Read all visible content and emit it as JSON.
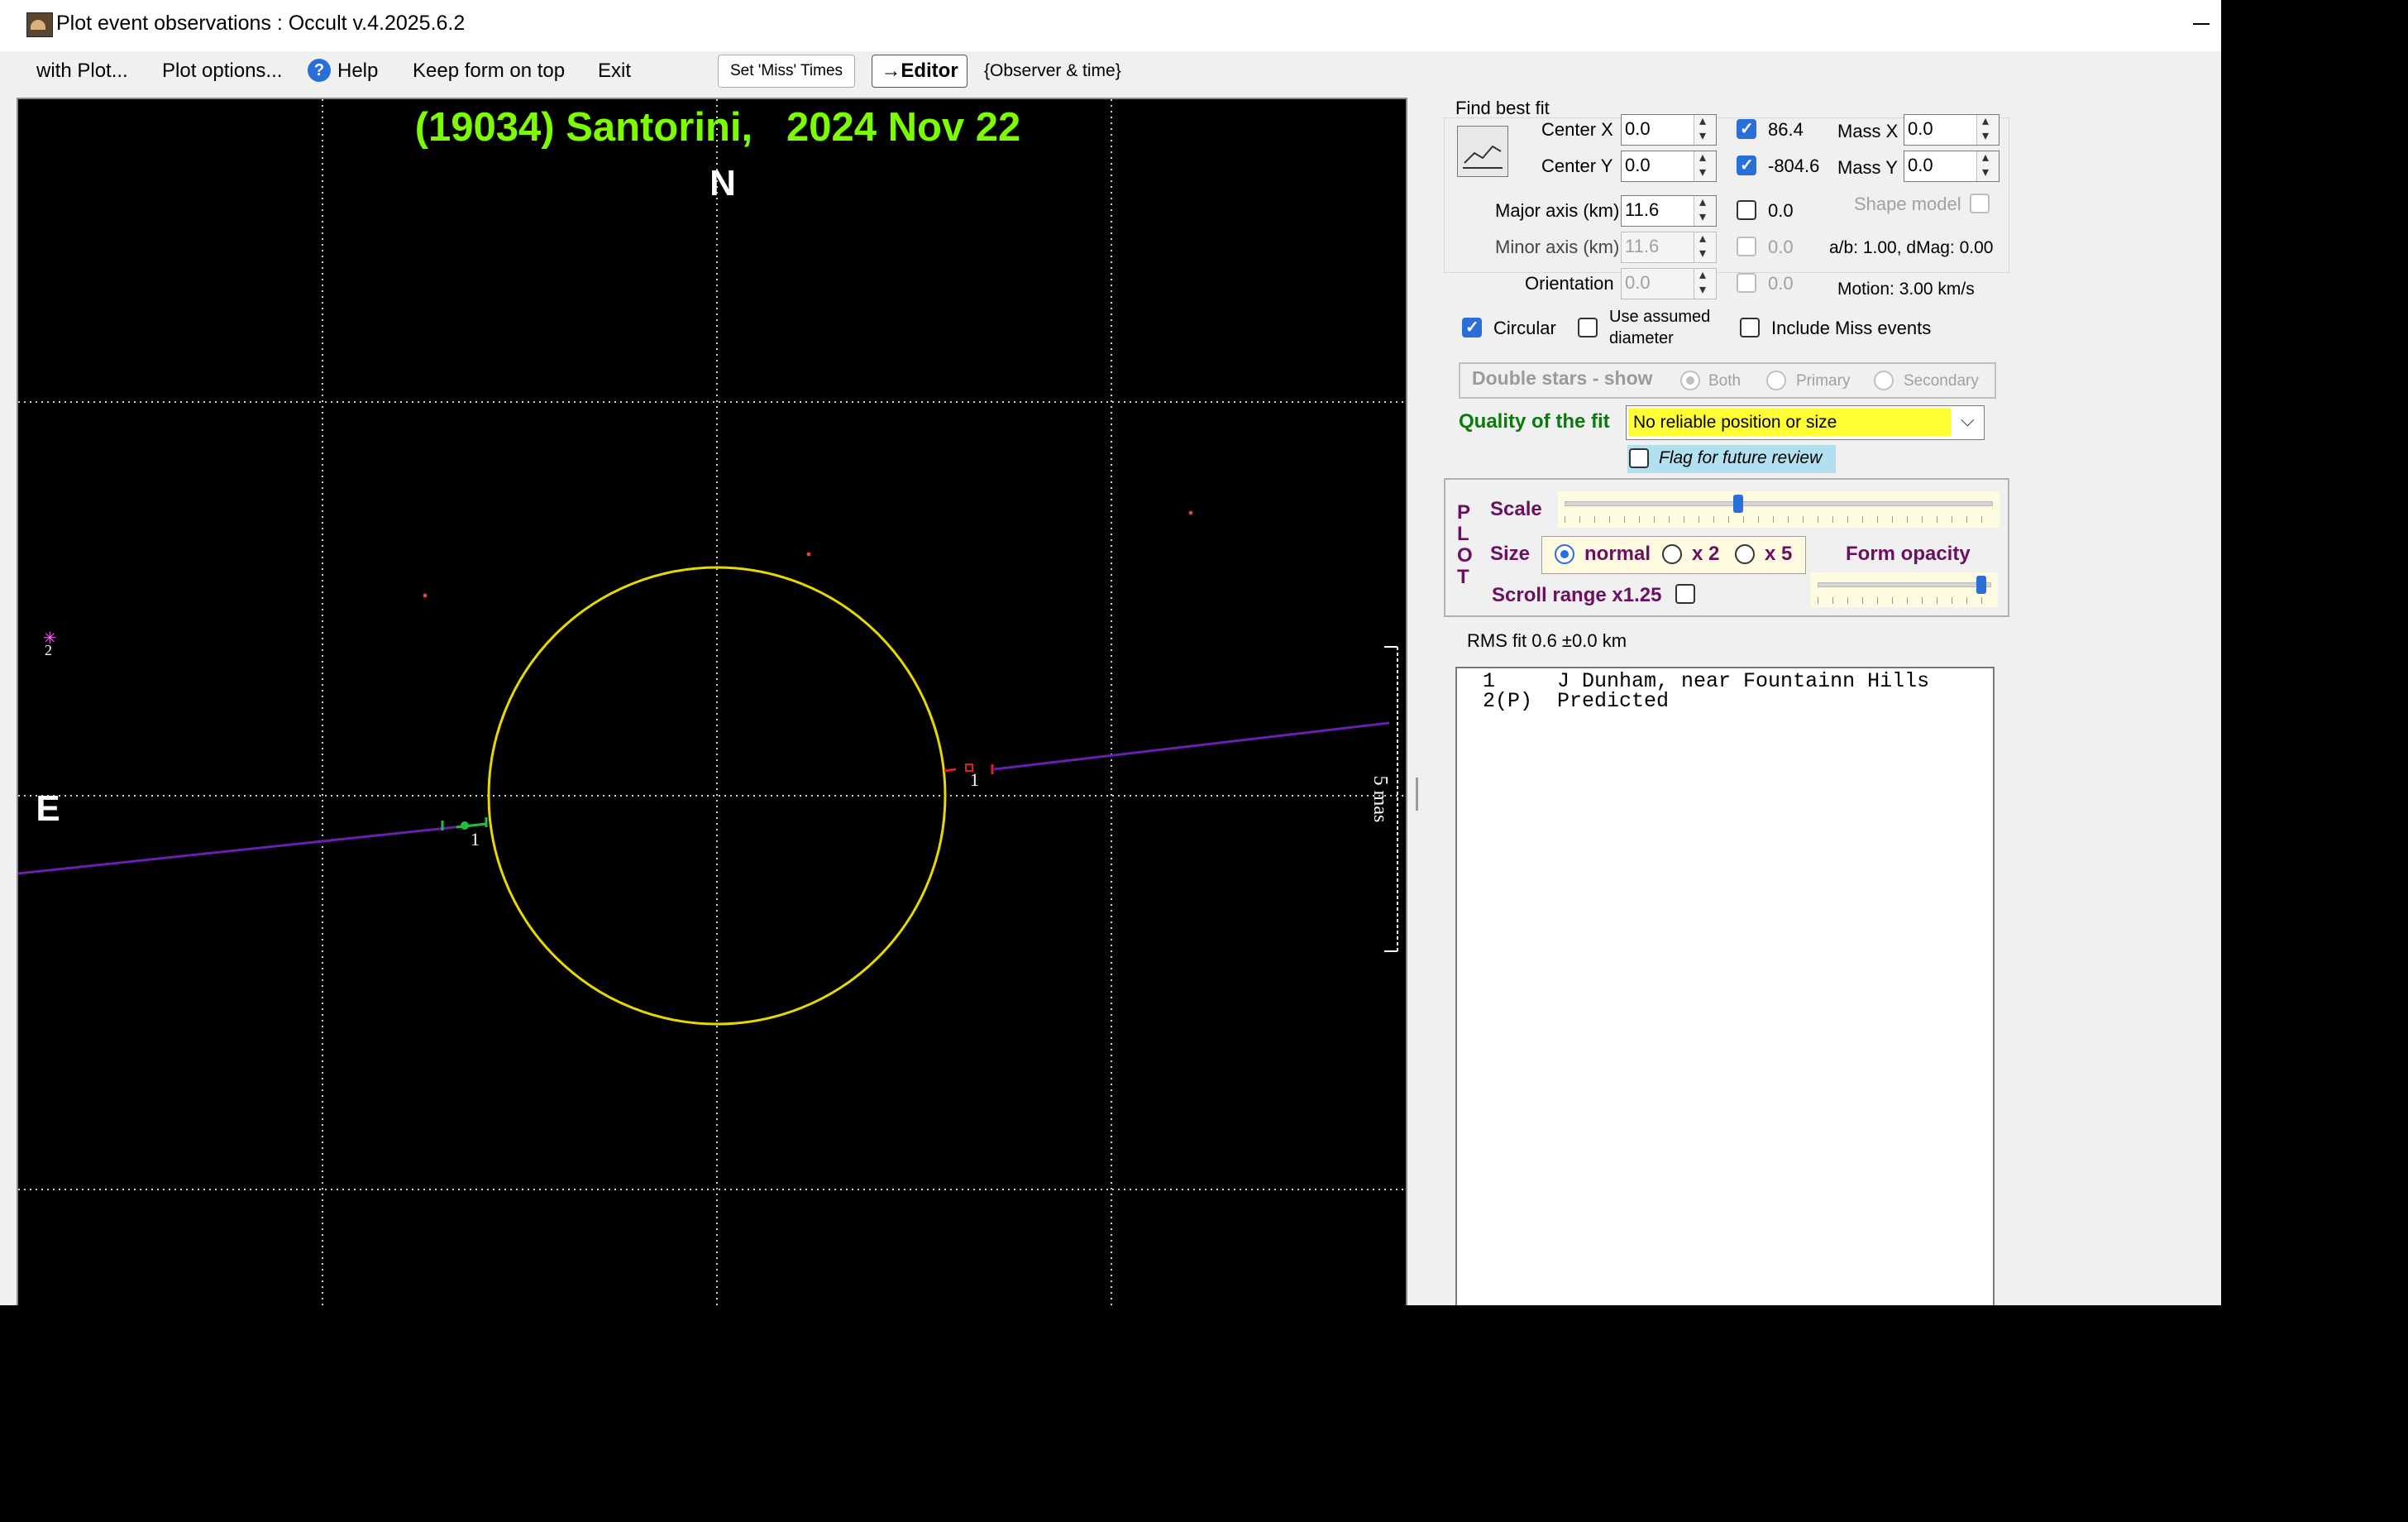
{
  "window": {
    "title": "Plot event observations : Occult v.4.2025.6.2"
  },
  "menu": {
    "items": [
      "with Plot...",
      "Plot options...",
      "Help",
      "Keep form on top",
      "Exit"
    ],
    "set_miss_times": "Set 'Miss' Times",
    "editor": "→Editor",
    "observer_time": "{Observer & time}"
  },
  "plot": {
    "title": "(19034) Santorini,   2024 Nov 22",
    "north": "N",
    "east": "E",
    "scale_label": "5 mas",
    "chord_label_left": "1",
    "chord_label_right": "1",
    "star_label": "2",
    "colors": {
      "title": "#7cfc00",
      "ellipse": "#e6d800",
      "chord": "#6a1fb0",
      "grid": "#d0d0d0",
      "disappear": "#20c040",
      "reappear": "#e02020"
    }
  },
  "fit": {
    "find_best_fit": "Find best fit",
    "center_x_label": "Center X",
    "center_x": "0.0",
    "center_y_label": "Center Y",
    "center_y": "0.0",
    "center_x_check": "86.4",
    "center_y_check": "-804.6",
    "mass_x_label": "Mass X",
    "mass_x": "0.0",
    "mass_y_label": "Mass Y",
    "mass_y": "0.0",
    "major_label": "Major axis (km)",
    "major": "11.6",
    "major_check": "0.0",
    "minor_label": "Minor axis (km)",
    "minor": "11.6",
    "minor_check": "0.0",
    "orient_label": "Orientation",
    "orient": "0.0",
    "orient_check": "0.0",
    "shape_model": "Shape model",
    "ab": "a/b: 1.00, dMag: 0.00",
    "motion": "Motion: 3.00 km/s",
    "circular": "Circular",
    "use_assumed": "Use assumed",
    "diameter": "diameter",
    "include_miss": "Include Miss events",
    "double_stars": "Double stars - show",
    "both": "Both",
    "primary": "Primary",
    "secondary": "Secondary",
    "quality_label": "Quality of the fit",
    "quality_value": "No reliable position or size",
    "flag_review": "Flag for future review"
  },
  "plotbox": {
    "letters": [
      "P",
      "L",
      "O",
      "T"
    ],
    "scale": "Scale",
    "size": "Size",
    "normal": "normal",
    "x2": "x 2",
    "x5": "x 5",
    "form_opacity": "Form opacity",
    "scroll_range": "Scroll range x1.25"
  },
  "rms": "RMS fit 0.6 ±0.0 km",
  "observers": [
    " 1     J Dunham, near Fountainn Hills",
    " 2(P)  Predicted"
  ]
}
